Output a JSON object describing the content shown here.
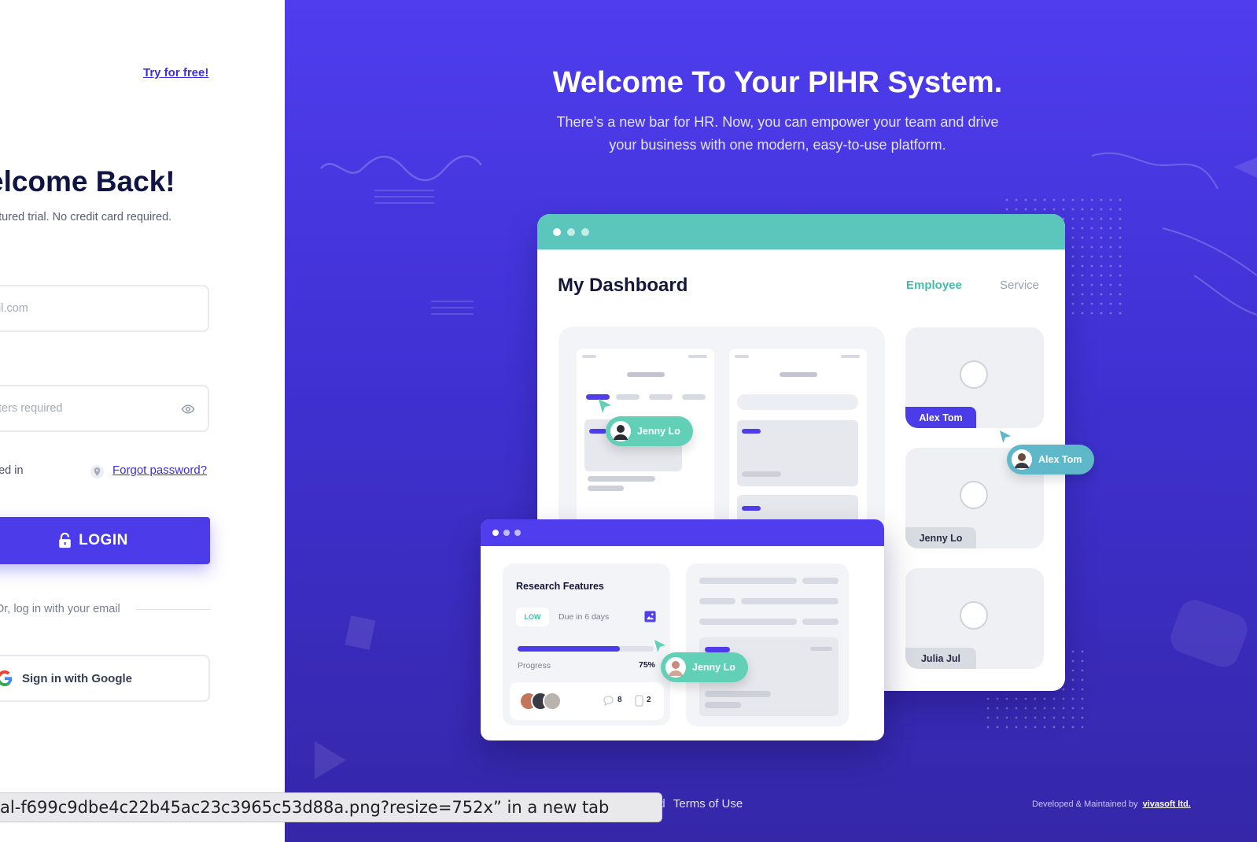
{
  "login": {
    "try_free": "Try for free!",
    "title": "elcome Back!",
    "subtitle": "featured trial. No credit card required.",
    "email_placeholder": "il.com",
    "password_placeholder": "ters required",
    "remember_label": "ned in",
    "forgot_password": "Forgot password?",
    "login_button": "LOGIN",
    "or_text": "Or, log in with your email",
    "google_button": "Sign in with Google"
  },
  "hero": {
    "title": "Welcome To Your PIHR System.",
    "subtitle_line1": "There’s a new bar for HR. Now, you can empower your team and drive",
    "subtitle_line2": "your business with one modern, easy-to-use platform."
  },
  "dashboard": {
    "title": "My Dashboard",
    "tab_employee": "Employee",
    "tab_service": "Service",
    "employees": [
      {
        "name": "Alex Tom"
      },
      {
        "name": "Jenny Lo"
      },
      {
        "name": "Julia Jul"
      }
    ],
    "tag_jenny": "Jenny Lo",
    "tag_alex": "Alex Tom",
    "tag_jenny_2": "Jenny Lo"
  },
  "research": {
    "title": "Research Features",
    "priority": "LOW",
    "due": "Due in 6 days",
    "progress_label": "Progress",
    "progress_text": "75%",
    "progress_value": 0.75,
    "comments": "8",
    "attachments": "2"
  },
  "footer": {
    "terms_prefix": "nd",
    "terms": "Terms of Use",
    "developed_by": "Developed & Maintained by",
    "company": "vivasoft ltd."
  },
  "browser": {
    "status_text": "al-f699c9dbe4c22b45ac23c3965c53d88a.png?resize=752x” in a new tab"
  },
  "colors": {
    "brand": "#4b3be8",
    "teal": "#5bc6bb",
    "bg_gradient_top": "#4f3dee",
    "bg_gradient_bottom": "#3527a8"
  }
}
